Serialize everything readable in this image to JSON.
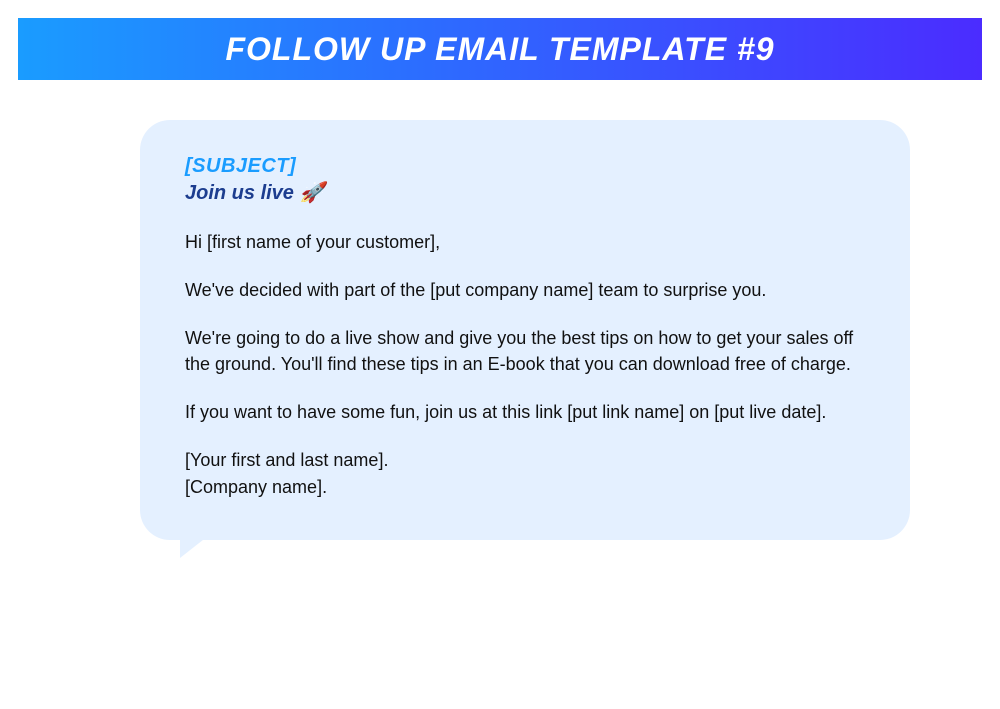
{
  "header": {
    "title": "FOLLOW UP EMAIL TEMPLATE #9"
  },
  "email": {
    "subject_label": "[SUBJECT]",
    "subject_line": "Join us live 🚀",
    "body": {
      "greeting": "Hi [first name of your customer],",
      "para1": "We've decided with part of the [put company name] team to surprise you.",
      "para2": "We're going to do a live show and give you the best tips on how to get your sales off the ground. You'll find these tips in an E-book that you can download free of charge.",
      "para3": "If you want to have some fun, join us at this link [put link name] on [put live date].",
      "signature_name": "[Your first and last name].",
      "signature_company": "[Company name]."
    }
  }
}
